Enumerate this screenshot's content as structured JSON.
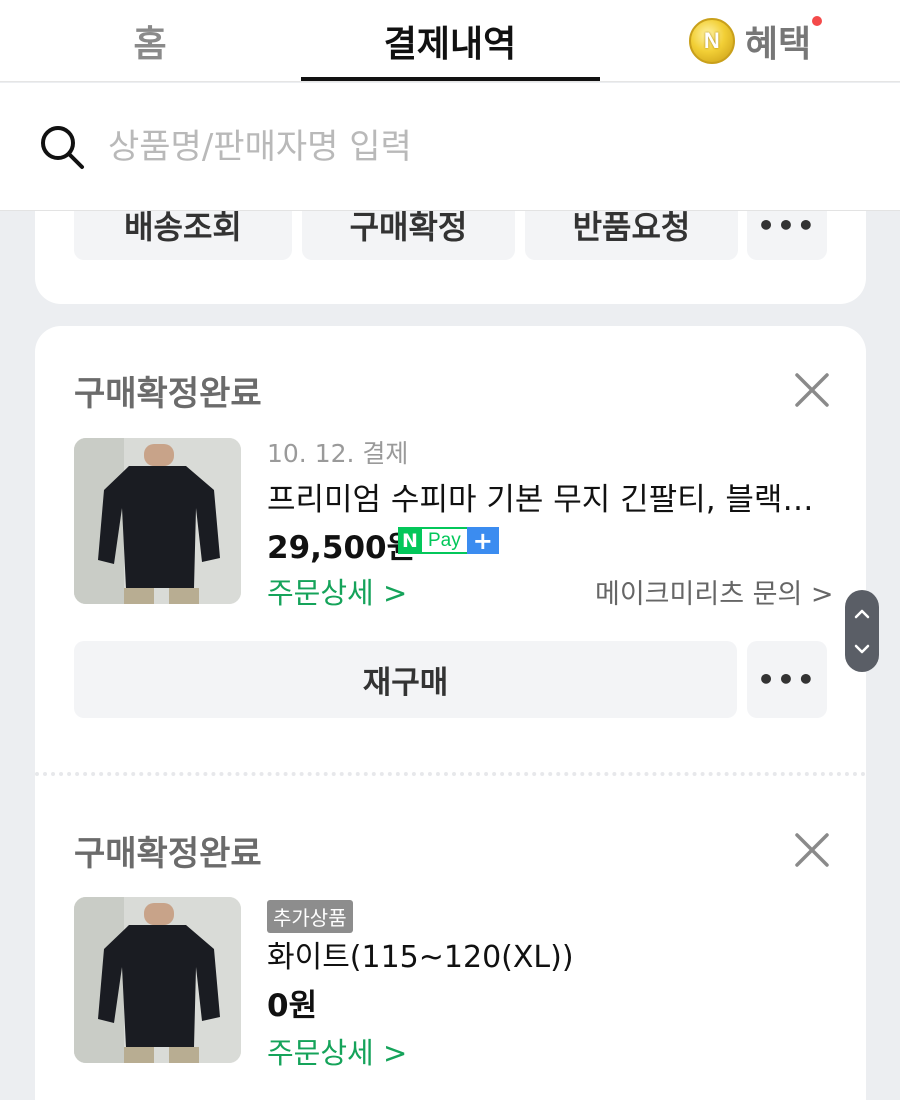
{
  "tabs": {
    "home": "홈",
    "payments": "결제내역",
    "benefits": "혜택",
    "coin_icon": "N"
  },
  "search": {
    "placeholder": "상품명/판매자명 입력",
    "icon": "search-icon"
  },
  "order_actions": {
    "track_delivery": "배송조회",
    "confirm_purchase": "구매확정",
    "return_request": "반품요청",
    "more": "•••"
  },
  "orders": [
    {
      "status": "구매확정완료",
      "date": "10. 12. 결제",
      "product_name": "프리미엄 수피마 기본 무지 긴팔티, 블랙 화...",
      "price": "29,500원",
      "payment_badge": {
        "n": "N",
        "pay": "Pay",
        "plus": "+"
      },
      "order_detail_link": "주문상세 >",
      "seller_inquiry_link": "메이크미리츠 문의 >",
      "rebuy_label": "재구매",
      "more": "•••"
    },
    {
      "status": "구매확정완료",
      "tag": "추가상품",
      "option_name": "화이트(115~120(XL))",
      "price": "0원",
      "order_detail_link": "주문상세 >"
    }
  ],
  "colors": {
    "green_link": "#15a35a",
    "npay_green": "#03c75a",
    "npay_blue": "#3b8cf0",
    "notification_dot": "#f44a4a"
  }
}
